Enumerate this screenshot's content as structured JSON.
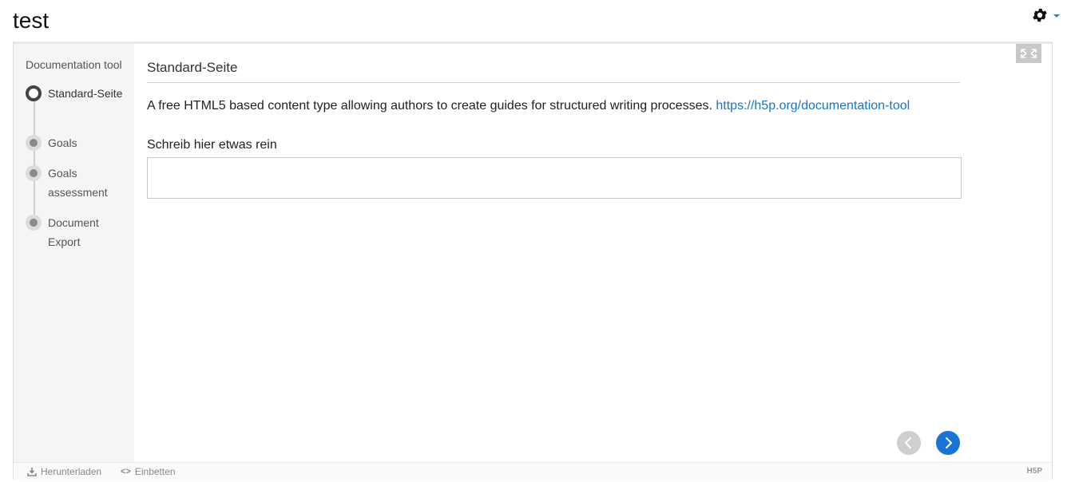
{
  "page": {
    "title": "test"
  },
  "header": {
    "settings_icon": "gear-icon",
    "caret_color": "#2c82c9"
  },
  "sidebar": {
    "title": "Documentation tool",
    "steps": [
      {
        "label": "Standard-Seite",
        "active": true
      },
      {
        "label": "Goals",
        "active": false
      },
      {
        "label": "Goals assessment",
        "active": false
      },
      {
        "label": "Document Export",
        "active": false
      }
    ]
  },
  "content": {
    "heading": "Standard-Seite",
    "text": "A free HTML5 based content type allowing authors to create guides for structured writing processes.",
    "link_text": "https://h5p.org/documentation-tool",
    "field_label": "Schreib hier etwas rein",
    "field_value": ""
  },
  "navigation": {
    "prev_icon": "chevron-left-icon",
    "next_icon": "chevron-right-icon",
    "accent": "#1a73d6"
  },
  "footer": {
    "download_label": "Herunterladen",
    "embed_label": "Einbetten",
    "logo": "H5P"
  }
}
